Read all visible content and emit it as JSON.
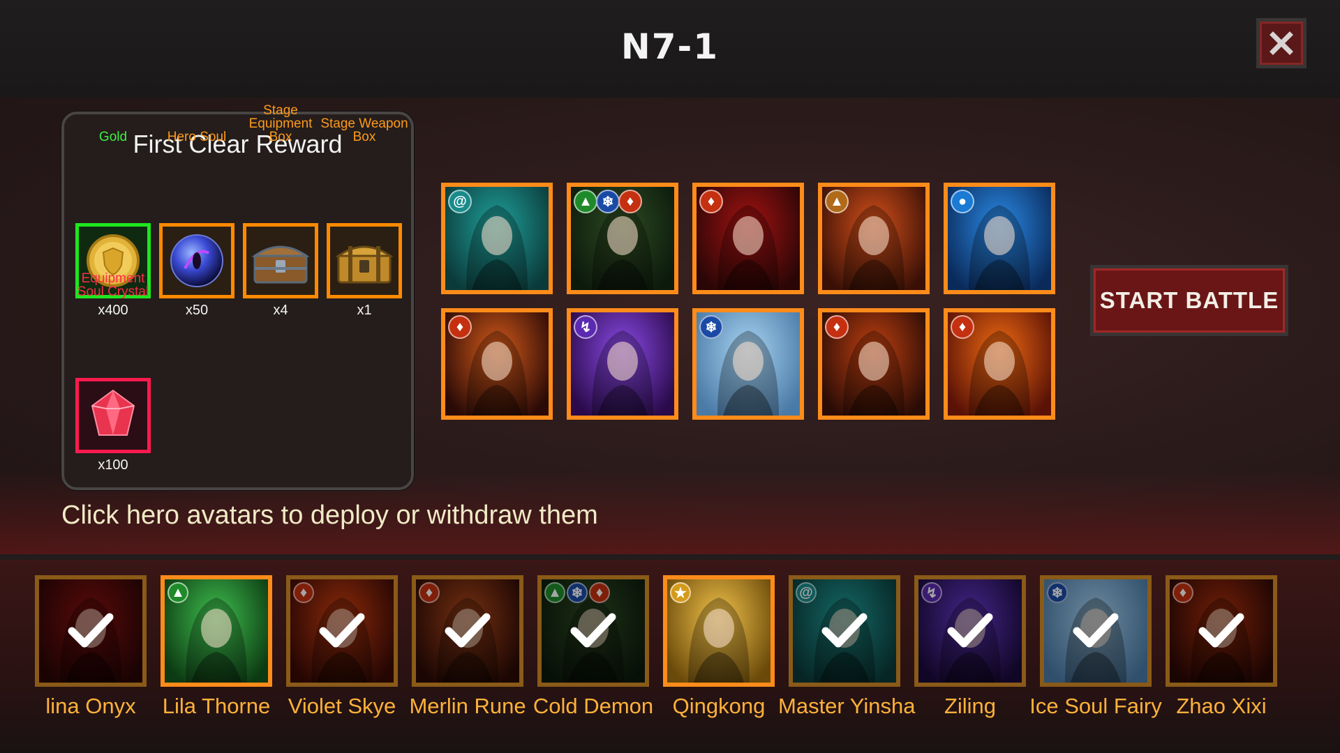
{
  "header": {
    "stage_title": "N7-1"
  },
  "reward_panel": {
    "title": "First Clear Reward",
    "items": [
      {
        "label": "Gold",
        "qty": "x400",
        "color": "#1ee61e",
        "icon": "gold-coin-icon"
      },
      {
        "label": "Hero Soul",
        "qty": "x50",
        "color": "#ff8a00",
        "icon": "hero-soul-orb-icon"
      },
      {
        "label": "Stage Equipment Box",
        "qty": "x4",
        "color": "#ff8a00",
        "icon": "equipment-chest-icon"
      },
      {
        "label": "Stage Weapon Box",
        "qty": "x1",
        "color": "#ff8a00",
        "icon": "weapon-chest-icon"
      },
      {
        "label": "Equipment Soul Crystal",
        "qty": "x100",
        "color": "#ff1a4e",
        "icon": "soul-crystal-icon"
      }
    ]
  },
  "hero_grid": [
    {
      "element": "wind",
      "palette": [
        "#1fa09a",
        "#0b3a3a"
      ]
    },
    {
      "element": "wood,ice,fire",
      "palette": [
        "#2e4a22",
        "#0c1a0c"
      ]
    },
    {
      "element": "fire",
      "palette": [
        "#a31212",
        "#2a0606"
      ]
    },
    {
      "element": "earth",
      "palette": [
        "#d4501a",
        "#3a1006"
      ]
    },
    {
      "element": "water",
      "palette": [
        "#2a8ae6",
        "#0a2a5a"
      ]
    },
    {
      "element": "fire",
      "palette": [
        "#d45a1a",
        "#2a0a06"
      ]
    },
    {
      "element": "lightning",
      "palette": [
        "#8a4ae6",
        "#2a0a4a"
      ]
    },
    {
      "element": "ice",
      "palette": [
        "#a8d4f2",
        "#4a7aa6"
      ]
    },
    {
      "element": "fire",
      "palette": [
        "#c04010",
        "#2a0c06"
      ]
    },
    {
      "element": "fire",
      "palette": [
        "#f06a12",
        "#5a1206"
      ]
    }
  ],
  "start_button": {
    "label": "START BATTLE"
  },
  "hint_text": "Click hero avatars to deploy or withdraw them",
  "roster": [
    {
      "name": "lina Onyx",
      "selected": true,
      "palette": [
        "#8a1010",
        "#2a0606"
      ],
      "element": ""
    },
    {
      "name": "Lila Thorne",
      "selected": false,
      "palette": [
        "#3fbf4f",
        "#0c3a12"
      ],
      "element": "wood"
    },
    {
      "name": "Violet Skye",
      "selected": true,
      "palette": [
        "#d44010",
        "#3a0a06"
      ],
      "element": "fire"
    },
    {
      "name": "Merlin Rune",
      "selected": true,
      "palette": [
        "#b44a1a",
        "#2a0a06"
      ],
      "element": "fire"
    },
    {
      "name": "Cold Demon",
      "selected": true,
      "palette": [
        "#2e4a22",
        "#0c1a0c"
      ],
      "element": "wood,ice,fire"
    },
    {
      "name": "Qingkong",
      "selected": false,
      "palette": [
        "#f2c24a",
        "#6a4a0a"
      ],
      "element": "light"
    },
    {
      "name": "Master Yinsha",
      "selected": true,
      "palette": [
        "#1fa09a",
        "#0b3a3a"
      ],
      "element": "wind"
    },
    {
      "name": "Ziling",
      "selected": true,
      "palette": [
        "#6a3ad4",
        "#1a0a3a"
      ],
      "element": "lightning"
    },
    {
      "name": "Ice Soul Fairy",
      "selected": true,
      "palette": [
        "#a8d4f2",
        "#4a7aa6"
      ],
      "element": "ice"
    },
    {
      "name": "Zhao Xixi",
      "selected": true,
      "palette": [
        "#b0300c",
        "#2a0806"
      ],
      "element": "fire"
    }
  ],
  "colors": {
    "accent_orange": "#ff8c1a",
    "name_orange": "#ffb23a",
    "hint_cream": "#f1eac6"
  }
}
